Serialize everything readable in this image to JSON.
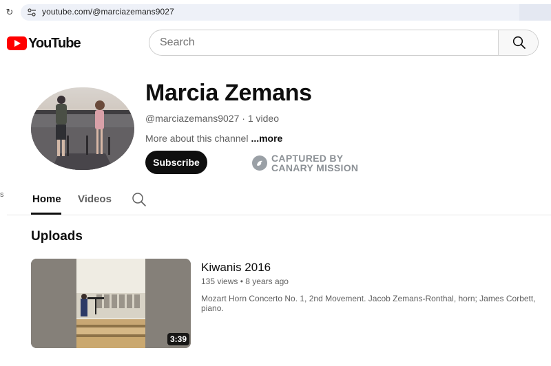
{
  "browser": {
    "url": "youtube.com/@marciazemans9027"
  },
  "header": {
    "logo_text": "YouTube",
    "search_placeholder": "Search"
  },
  "channel": {
    "name": "Marcia Zemans",
    "handle": "@marciazemans9027",
    "separator": "·",
    "video_count": "1 video",
    "about_text": "More about this channel",
    "about_more": "...more",
    "subscribe_label": "Subscribe",
    "captured_line1": "CAPTURED BY",
    "captured_line2": "CANARY MISSION"
  },
  "side_fragment": "s",
  "tabs": [
    {
      "label": "Home",
      "active": true
    },
    {
      "label": "Videos",
      "active": false
    }
  ],
  "uploads": {
    "section_title": "Uploads",
    "videos": [
      {
        "title": "Kiwanis 2016",
        "views": "135 views",
        "dot": "•",
        "age": "8 years ago",
        "description": "Mozart Horn Concerto No. 1, 2nd Movement. Jacob Zemans-Ronthal, horn; James Corbett, piano.",
        "duration": "3:39"
      }
    ]
  },
  "colors": {
    "brand_red": "#ff0000",
    "subscribe_bg": "#0f0f0f",
    "secondary_text": "#606060"
  }
}
